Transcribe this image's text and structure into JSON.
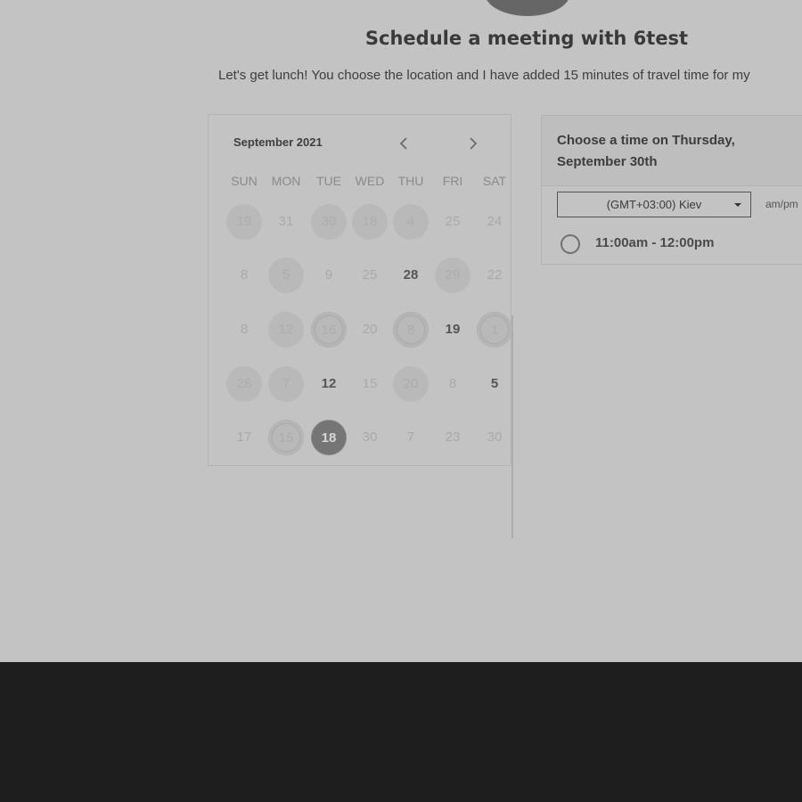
{
  "header": {
    "title": "Schedule a meeting with 6test",
    "subtitle": "Let's get lunch! You choose the location and I have added 15 minutes of travel time for my"
  },
  "calendar": {
    "month_label": "September 2021",
    "weekdays": [
      "SUN",
      "MON",
      "TUE",
      "WED",
      "THU",
      "FRI",
      "SAT"
    ],
    "weeks": [
      [
        {
          "label": "19",
          "state": "available"
        },
        {
          "label": "31",
          "state": "disabled"
        },
        {
          "label": "30",
          "state": "available"
        },
        {
          "label": "18",
          "state": "available"
        },
        {
          "label": "4",
          "state": "available"
        },
        {
          "label": "25",
          "state": "disabled"
        },
        {
          "label": "24",
          "state": "disabled"
        }
      ],
      [
        {
          "label": "8",
          "state": "disabled"
        },
        {
          "label": "5",
          "state": "available"
        },
        {
          "label": "9",
          "state": "disabled"
        },
        {
          "label": "25",
          "state": "disabled"
        },
        {
          "label": "28",
          "state": "bold"
        },
        {
          "label": "29",
          "state": "available"
        },
        {
          "label": "22",
          "state": "disabled"
        }
      ],
      [
        {
          "label": "8",
          "state": "disabled"
        },
        {
          "label": "12",
          "state": "available"
        },
        {
          "label": "16",
          "state": "dotted"
        },
        {
          "label": "20",
          "state": "disabled"
        },
        {
          "label": "8",
          "state": "dotted"
        },
        {
          "label": "19",
          "state": "bold"
        },
        {
          "label": "1",
          "state": "dotted"
        }
      ],
      [
        {
          "label": "28",
          "state": "available"
        },
        {
          "label": "7",
          "state": "available"
        },
        {
          "label": "12",
          "state": "bold"
        },
        {
          "label": "15",
          "state": "disabled"
        },
        {
          "label": "20",
          "state": "available"
        },
        {
          "label": "8",
          "state": "disabled"
        },
        {
          "label": "5",
          "state": "bold"
        }
      ],
      [
        {
          "label": "17",
          "state": "disabled"
        },
        {
          "label": "15",
          "state": "dotted"
        },
        {
          "label": "18",
          "state": "selected"
        },
        {
          "label": "30",
          "state": "disabled"
        },
        {
          "label": "7",
          "state": "disabled"
        },
        {
          "label": "23",
          "state": "disabled"
        },
        {
          "label": "30",
          "state": "disabled"
        }
      ]
    ]
  },
  "time_panel": {
    "title": "Choose a time on Thursday, September 30th",
    "timezone": "(GMT+03:00) Kiev",
    "format_label": "am/pm",
    "slots": [
      "11:00am - 12:00pm"
    ]
  },
  "icons": {
    "prev": "chevron-left-icon",
    "next": "chevron-right-icon",
    "dropdown": "caret-down-icon"
  }
}
